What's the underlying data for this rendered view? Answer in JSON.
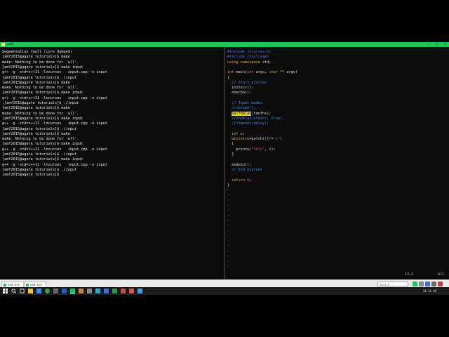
{
  "window": {
    "title": "cmd"
  },
  "terminal": {
    "lines": [
      "Segmentation fault (core dumped)",
      "[amf2015@agate tutorials]$ make",
      "make: Nothing to be done for 'all'.",
      "[amf2015@agate tutorials]$ make input",
      "g++ -g -std=c++11 -lncurses   input.cpp -o input",
      "[amf2015@agate tutorials]$ ./input",
      "[amf2015@agate tutorials]$ make",
      "make: Nothing to be done for 'all'.",
      "[amf2015@agate tutorials]$ make input",
      "g++ -g -std=c++11 -lncurses   input.cpp -o input",
      ".[amf2015@agate tutorials]$ ./input",
      "[amf2015@agate tutorials]$ make",
      "make: Nothing to be done for 'all'.",
      "[amf2015@agate tutorials]$ make input",
      "g++ -g -std=c++11 -lncurses   input.cpp -o input",
      "[amf2015@agate tutorials]$ ./input",
      "[amf2015@agate tutorials]$ make",
      "make: Nothing to be done for 'all'.",
      "[amf2015@agate tutorials]$ make input",
      "g++ -g -std=c++11 -lncurses   input.cpp -o input",
      "[amf2015@agate tutorials]$ ./input",
      "[amf2015@agate tutorials]$ make input",
      "g++ -g -std=c++11 -lncurses   input.cpp -o input",
      "[amf2015@agate tutorials]$ ./input",
      "[amf2015@agate tutorials]$"
    ]
  },
  "vim": {
    "lines": [
      [
        {
          "t": "#include <ncurses.h>",
          "c": "c-pre"
        }
      ],
      [
        {
          "t": "#include <iostream>",
          "c": "c-pre"
        }
      ],
      [
        {
          "t": "using",
          "c": "c-kw"
        },
        {
          "t": " "
        },
        {
          "t": "namespace",
          "c": "c-kw"
        },
        {
          "t": " std;"
        }
      ],
      [
        {
          "t": ""
        }
      ],
      [
        {
          "t": "int",
          "c": "c-kw"
        },
        {
          "t": " main("
        },
        {
          "t": "int",
          "c": "c-kw"
        },
        {
          "t": " argc, "
        },
        {
          "t": "char",
          "c": "c-kw"
        },
        {
          "t": " ** argv)"
        }
      ],
      [
        {
          "t": "{"
        }
      ],
      [
        {
          "t": "  "
        },
        {
          "t": "// Start ncurses",
          "c": "c-cm"
        }
      ],
      [
        {
          "t": "  initscr();"
        }
      ],
      [
        {
          "t": "  noecho();"
        }
      ],
      [
        {
          "t": ""
        }
      ],
      [
        {
          "t": "  "
        },
        {
          "t": "// Input modes",
          "c": "c-cm"
        }
      ],
      [
        {
          "t": "  "
        },
        {
          "t": "//cbreak();",
          "c": "c-cm"
        }
      ],
      [
        {
          "t": "  "
        },
        {
          "t": "halfdelay",
          "c": "c-hl"
        },
        {
          "t": "(tenths);"
        }
      ],
      [
        {
          "t": "  "
        },
        {
          "t": "//nodelay(stdscr, true);",
          "c": "c-cm"
        }
      ],
      [
        {
          "t": "  "
        },
        {
          "t": "//timeout(delay);",
          "c": "c-cm"
        }
      ],
      [
        {
          "t": ""
        }
      ],
      [
        {
          "t": "  "
        },
        {
          "t": "int",
          "c": "c-kw"
        },
        {
          "t": " c;"
        }
      ],
      [
        {
          "t": "  "
        },
        {
          "t": "while",
          "c": "c-kw"
        },
        {
          "t": "((c=getch())!="
        },
        {
          "t": "'x'",
          "c": "c-str"
        },
        {
          "t": ")"
        }
      ],
      [
        {
          "t": "  {"
        }
      ],
      [
        {
          "t": "    printw("
        },
        {
          "t": "\"%d\\n\"",
          "c": "c-str"
        },
        {
          "t": ", c);"
        }
      ],
      [
        {
          "t": "  }"
        }
      ],
      [
        {
          "t": ""
        }
      ],
      [
        {
          "t": "  endwin();"
        }
      ],
      [
        {
          "t": "  "
        },
        {
          "t": "// End ncurses",
          "c": "c-cm"
        }
      ],
      [
        {
          "t": ""
        }
      ],
      [
        {
          "t": "  "
        },
        {
          "t": "return",
          "c": "c-kw"
        },
        {
          "t": " "
        },
        {
          "t": "0",
          "c": "c-str"
        },
        {
          "t": ";"
        }
      ],
      [
        {
          "t": "}"
        }
      ],
      [
        {
          "t": "~",
          "c": "c-tilde"
        }
      ],
      [
        {
          "t": "~",
          "c": "c-tilde"
        }
      ],
      [
        {
          "t": "~",
          "c": "c-tilde"
        }
      ],
      [
        {
          "t": "~",
          "c": "c-tilde"
        }
      ],
      [
        {
          "t": "~",
          "c": "c-tilde"
        }
      ],
      [
        {
          "t": "~",
          "c": "c-tilde"
        }
      ],
      [
        {
          "t": "~",
          "c": "c-tilde"
        }
      ],
      [
        {
          "t": "~",
          "c": "c-tilde"
        }
      ],
      [
        {
          "t": "~",
          "c": "c-tilde"
        }
      ],
      [
        {
          "t": "~",
          "c": "c-tilde"
        }
      ],
      [
        {
          "t": "~",
          "c": "c-tilde"
        }
      ],
      [
        {
          "t": "~",
          "c": "c-tilde"
        }
      ],
      [
        {
          "t": "~",
          "c": "c-tilde"
        }
      ],
      [
        {
          "t": "~",
          "c": "c-tilde"
        }
      ],
      [
        {
          "t": "~",
          "c": "c-tilde"
        }
      ],
      [
        {
          "t": "~",
          "c": "c-tilde"
        }
      ]
    ],
    "status_pos": "13,2",
    "status_scroll": "All"
  },
  "tabs": [
    {
      "label": "cmd.exe"
    },
    {
      "label": "cmd.exe"
    }
  ],
  "search": {
    "placeholder": "Search"
  },
  "clock": {
    "time": "10:34 AM"
  },
  "colors": {
    "titlebar": "#1fc35a",
    "terminal_bg": "#0c0c0c"
  },
  "icons": [
    "start-icon",
    "search-icon",
    "task-view-icon",
    "file-explorer-icon",
    "store-icon",
    "chrome-icon",
    "terminal-icon",
    "mail-icon",
    "app-icon"
  ]
}
